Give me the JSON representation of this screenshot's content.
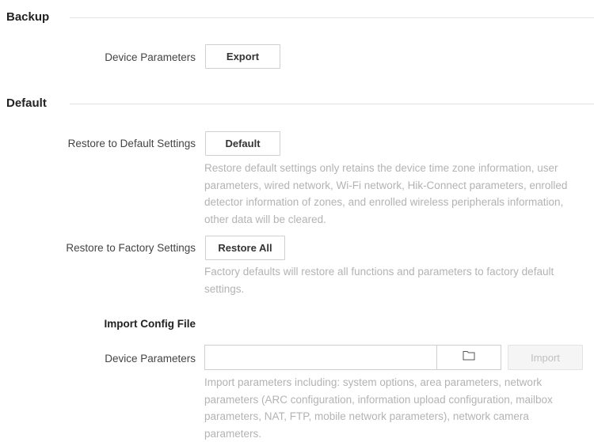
{
  "backup": {
    "title": "Backup",
    "device_parameters_label": "Device Parameters",
    "export_label": "Export"
  },
  "default": {
    "title": "Default",
    "restore_default_label": "Restore to Default Settings",
    "default_button_label": "Default",
    "restore_default_hint": "Restore default settings only retains the device time zone information, user parameters, wired network, Wi-Fi network, Hik-Connect parameters, enrolled detector information of zones, and enrolled wireless peripherals information, other data will be cleared.",
    "restore_factory_label": "Restore to Factory Settings",
    "restore_all_label": "Restore All",
    "restore_factory_hint": "Factory defaults will restore all functions and parameters to factory default settings."
  },
  "import_config": {
    "title": "Import Config File",
    "device_parameters_label": "Device Parameters",
    "file_value": "",
    "browse_icon": "folder-icon",
    "import_label": "Import",
    "import_hint": "Import parameters including: system options, area parameters, network parameters (ARC configuration, information upload configuration, mailbox parameters, NAT, FTP, mobile network parameters), network camera parameters."
  }
}
